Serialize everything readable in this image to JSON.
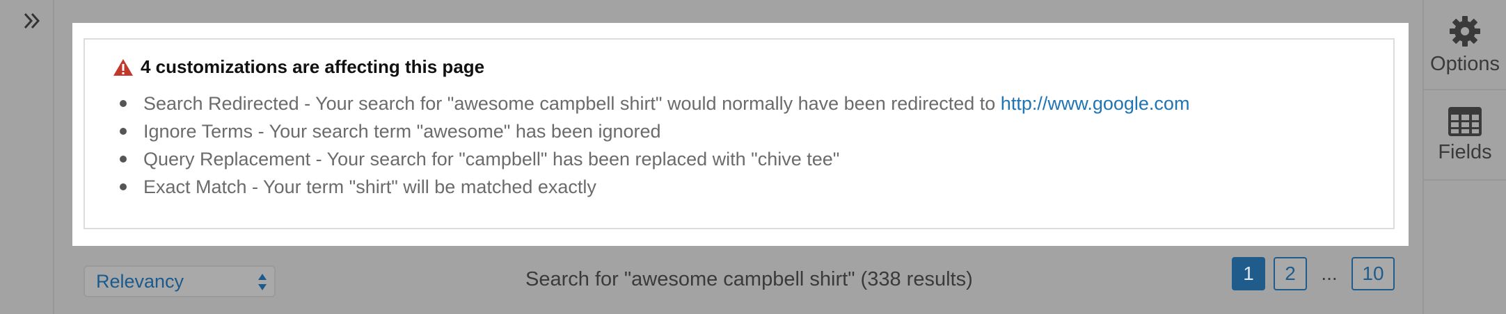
{
  "left_rail": {
    "expand_icon": "double-chevron-right-icon"
  },
  "right_rail": {
    "options": {
      "label": "Options",
      "icon": "gear-icon"
    },
    "fields": {
      "label": "Fields",
      "icon": "table-grid-icon"
    }
  },
  "notice": {
    "icon": "warning-triangle-icon",
    "icon_color": "#c0392b",
    "title": "4 customizations are affecting this page",
    "items": [
      "Search Redirected - Your search for \"awesome campbell shirt\" would normally have been redirected to ",
      "Ignore Terms - Your search term \"awesome\" has been ignored",
      "Query Replacement - Your search for \"campbell\" has been replaced with \"chive tee\"",
      "Exact Match - Your term \"shirt\" will be matched exactly"
    ],
    "redirect_link": "http://www.google.com"
  },
  "toolbar": {
    "sort_value": "Relevancy",
    "results_text": "Search for \"awesome campbell shirt\" (338 results)"
  },
  "pagination": {
    "pages": [
      "1",
      "2",
      "10"
    ],
    "ellipsis": "...",
    "current": "1",
    "accent": "#1f5c8c"
  }
}
